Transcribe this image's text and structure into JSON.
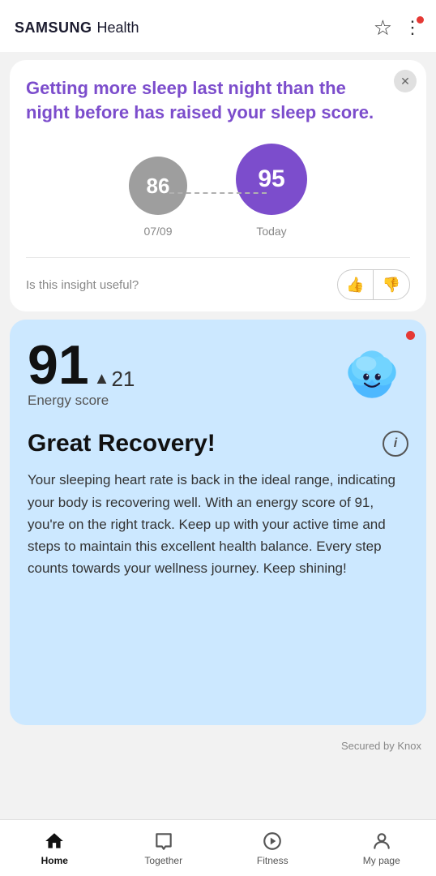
{
  "header": {
    "brand": "SAMSUNG",
    "app": "Health"
  },
  "sleep_card": {
    "title": "Getting more sleep last night than the night before has raised your sleep score.",
    "score_prev": "86",
    "score_prev_date": "07/09",
    "score_today": "95",
    "score_today_label": "Today",
    "feedback_label": "Is this insight useful?"
  },
  "energy_card": {
    "score": "91",
    "change": "21",
    "energy_label": "Energy score",
    "recovery_title": "Great Recovery!",
    "body_text": "Your sleeping heart rate is back in the ideal range, indicating your body is recovering well. With an energy score of 91, you're on the right track. Keep up with your active time and steps to maintain this excellent health balance. Every step counts towards your wellness journey. Keep shining!"
  },
  "knox": {
    "label": "Secured by Knox"
  },
  "bottom_nav": {
    "items": [
      {
        "id": "home",
        "label": "Home",
        "active": true
      },
      {
        "id": "together",
        "label": "Together",
        "active": false
      },
      {
        "id": "fitness",
        "label": "Fitness",
        "active": false
      },
      {
        "id": "my-page",
        "label": "My page",
        "active": false
      }
    ]
  }
}
